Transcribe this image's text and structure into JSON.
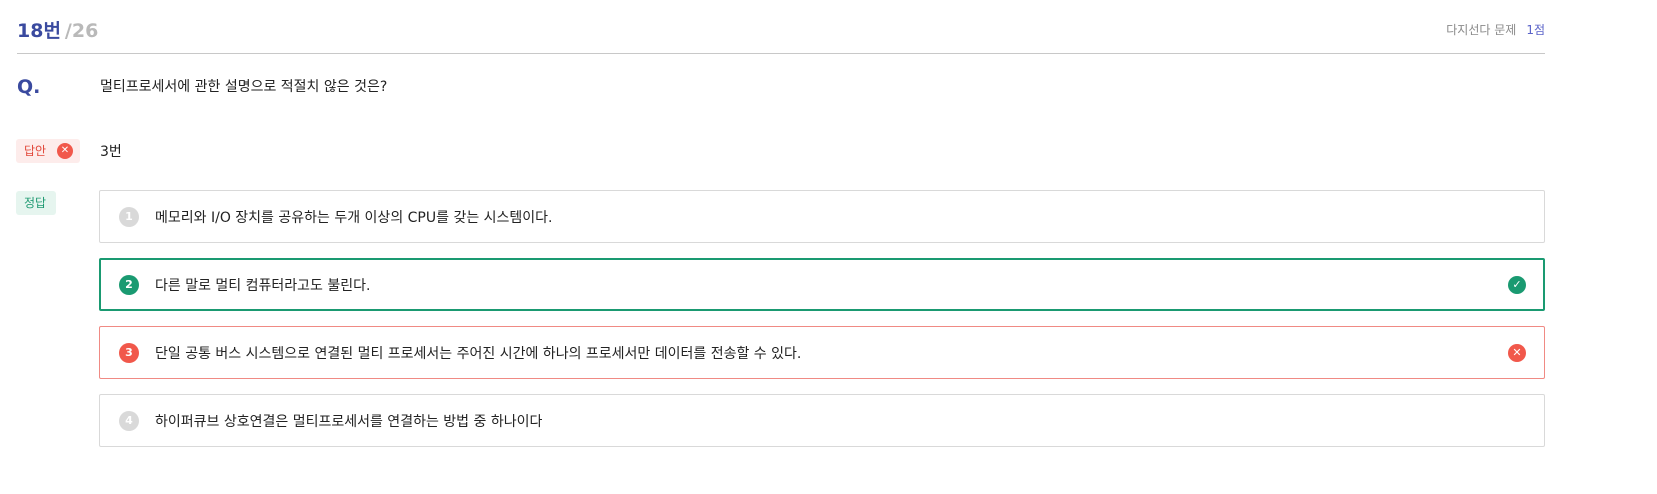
{
  "header": {
    "question_number": "18번",
    "question_total": "/26",
    "question_type": "다지선다 문제",
    "points": "1점"
  },
  "question": {
    "label": "Q.",
    "text": "멀티프로세서에 관한 설명으로 적절치 않은 것은?"
  },
  "answer": {
    "tag_label": "답안",
    "value": "3번"
  },
  "correct": {
    "tag_label": "정답"
  },
  "options": [
    {
      "number": "1",
      "text": "메모리와 I/O 장치를 공유하는 두개 이상의 CPU를 갖는 시스템이다.",
      "state": "normal"
    },
    {
      "number": "2",
      "text": "다른 말로 멀티 컴퓨터라고도 불린다.",
      "state": "correct"
    },
    {
      "number": "3",
      "text": "단일 공통 버스 시스템으로 연결된 멀티 프로세서는 주어진 시간에 하나의 프로세서만 데이터를 전송할 수 있다.",
      "state": "wrong"
    },
    {
      "number": "4",
      "text": "하이퍼큐브 상호연결은 멀티프로세서를 연결하는 방법 중 하나이다",
      "state": "normal"
    }
  ],
  "icons": {
    "check": "check-circle-icon",
    "cross": "x-circle-icon"
  },
  "colors": {
    "accent": "#3a4a9f",
    "correct": "#1a9a71",
    "wrong": "#f1584b"
  }
}
